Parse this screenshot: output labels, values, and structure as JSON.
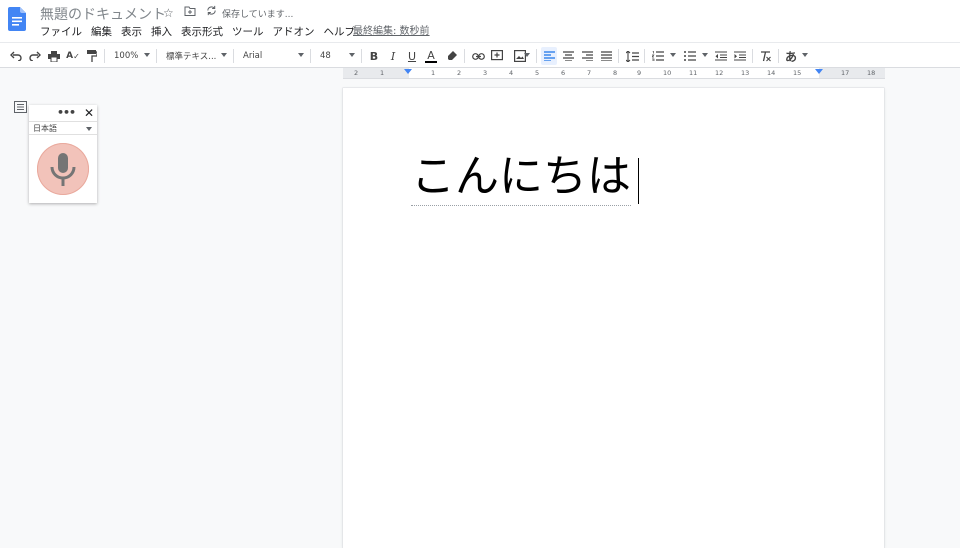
{
  "header": {
    "title": "無題のドキュメント",
    "saving_status": "保存しています...",
    "last_edit": "最終編集: 数秒前",
    "menu": [
      "ファイル",
      "編集",
      "表示",
      "挿入",
      "表示形式",
      "ツール",
      "アドオン",
      "ヘルプ"
    ]
  },
  "toolbar": {
    "zoom": "100%",
    "style": "標準テキス...",
    "font": "Arial",
    "font_size": "48",
    "input_tools": "あ"
  },
  "ruler": {
    "labels": [
      "2",
      "1",
      "1",
      "2",
      "3",
      "4",
      "5",
      "6",
      "7",
      "8",
      "9",
      "10",
      "11",
      "12",
      "13",
      "14",
      "15",
      "17",
      "18"
    ]
  },
  "document": {
    "text": "こんにちは"
  },
  "voice_typing": {
    "menu": "•••",
    "close": "✕",
    "language": "日本語"
  },
  "colors": {
    "accent": "#4285f4",
    "mic": "#f2c3ba",
    "mic_icon": "#757575"
  }
}
